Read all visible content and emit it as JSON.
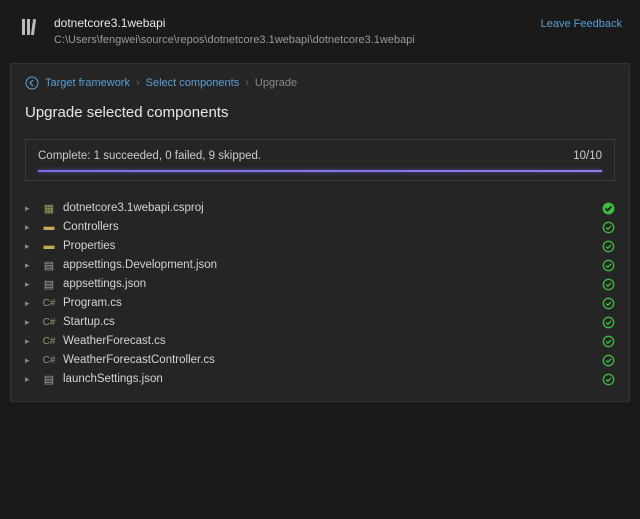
{
  "header": {
    "title": "dotnetcore3.1webapi",
    "path": "C:\\Users\\fengwei\\source\\repos\\dotnetcore3.1webapi\\dotnetcore3.1webapi",
    "feedback_label": "Leave Feedback"
  },
  "breadcrumb": {
    "items": [
      "Target framework",
      "Select components",
      "Upgrade"
    ]
  },
  "page_title": "Upgrade selected components",
  "progress": {
    "status_text": "Complete: 1 succeeded, 0 failed, 9 skipped.",
    "counter": "10/10"
  },
  "items": [
    {
      "name": "dotnetcore3.1webapi.csproj",
      "type": "csproj",
      "status": "success"
    },
    {
      "name": "Controllers",
      "type": "folder",
      "status": "skipped"
    },
    {
      "name": "Properties",
      "type": "folder",
      "status": "skipped"
    },
    {
      "name": "appsettings.Development.json",
      "type": "json",
      "status": "skipped"
    },
    {
      "name": "appsettings.json",
      "type": "json",
      "status": "skipped"
    },
    {
      "name": "Program.cs",
      "type": "cs",
      "status": "skipped"
    },
    {
      "name": "Startup.cs",
      "type": "cs",
      "status": "skipped"
    },
    {
      "name": "WeatherForecast.cs",
      "type": "cs",
      "status": "skipped"
    },
    {
      "name": "WeatherForecastController.cs",
      "type": "cs",
      "status": "skipped"
    },
    {
      "name": "launchSettings.json",
      "type": "json",
      "status": "skipped"
    }
  ]
}
